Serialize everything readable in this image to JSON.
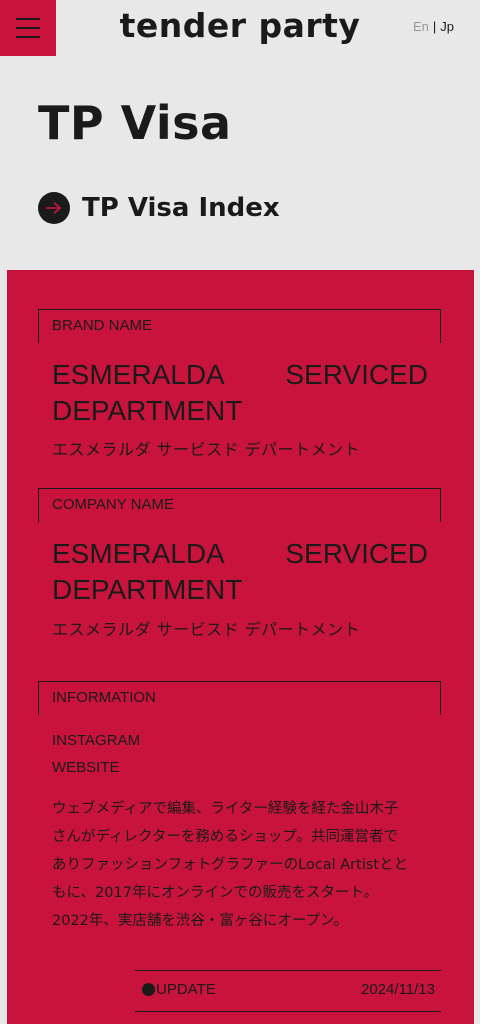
{
  "header": {
    "logo": "tender party",
    "lang_en": "En",
    "lang_sep": "|",
    "lang_jp": "Jp"
  },
  "page": {
    "title": "TP Visa",
    "index_link": "TP Visa Index"
  },
  "brand": {
    "label": "BRAND NAME",
    "name_word1": "ESMERALDA",
    "name_word2": "SERVICED",
    "name_word3": "DEPARTMENT",
    "kana": "エスメラルダ サービスド デパートメント"
  },
  "company": {
    "label": "COMPANY NAME",
    "name_word1": "ESMERALDA",
    "name_word2": "SERVICED",
    "name_word3": "DEPARTMENT",
    "kana": "エスメラルダ サービスド デパートメント"
  },
  "information": {
    "label": "INFORMATION",
    "instagram": "INSTAGRAM",
    "website": "WEBSITE",
    "description_lines": [
      "ウェブメディアで編集、ライター経験を経た金山木子",
      "さんがディレクターを務めるショップ。共同運営者で",
      "ありファッションフォトグラファーのLocal Artistとと",
      "もに、2017年にオンラインでの販売をスタート。",
      "2022年、実店舗を渋谷・富ヶ谷にオープン。"
    ]
  },
  "update": {
    "label": "UPDATE",
    "date": "2024/11/13"
  },
  "colors": {
    "accent": "#c8143c",
    "background": "#e8e8e8",
    "ink": "#1a1a1a",
    "muted": "#999999"
  },
  "icons": {
    "menu": "hamburger-menu-icon",
    "index_arrow": "arrow-right-icon",
    "update_dot": "dot-icon"
  }
}
